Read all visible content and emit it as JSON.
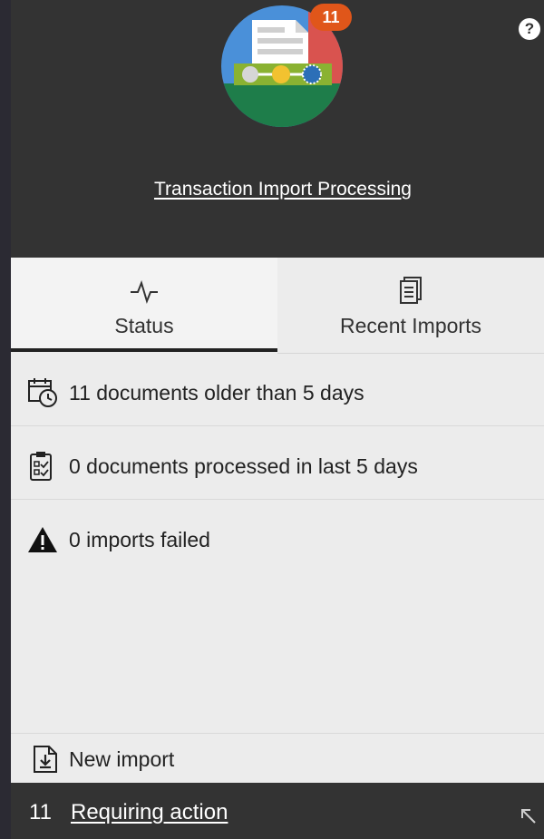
{
  "header": {
    "help_symbol": "?",
    "badge_count": "11",
    "title": "Transaction Import Processing"
  },
  "tabs": [
    {
      "label": "Status",
      "icon": "activity-icon",
      "selected": true
    },
    {
      "label": "Recent Imports",
      "icon": "document-icon",
      "selected": false
    }
  ],
  "status_items": [
    {
      "icon": "calendar-clock-icon",
      "text": "11 documents older than 5 days"
    },
    {
      "icon": "clipboard-check-icon",
      "text": "0 documents processed in last 5 days"
    },
    {
      "icon": "warning-icon",
      "text": "0 imports failed"
    }
  ],
  "actions": {
    "new_import": "New import"
  },
  "footer": {
    "count": "11",
    "link": "Requiring action"
  },
  "colors": {
    "header_bg": "#333333",
    "panel_bg": "#ececec",
    "badge": "#e0561a"
  }
}
